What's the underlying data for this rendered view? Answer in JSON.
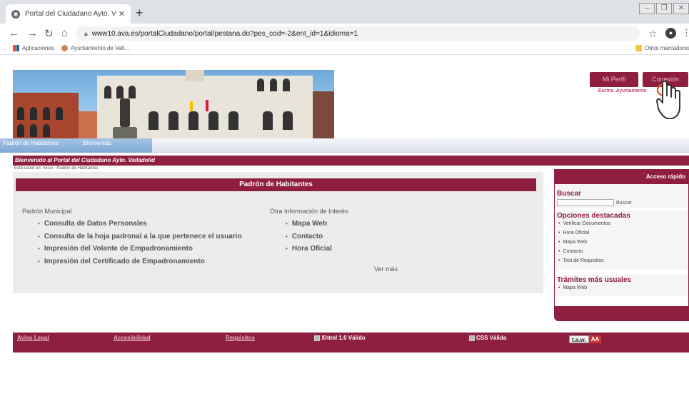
{
  "browser": {
    "tab_title": "Portal del Ciudadano Ayto. Vallado",
    "url": "www10.ava.es/portalCiudadano/portal/pestana.do?pes_cod=-2&ent_id=1&idioma=1",
    "bookmarks": [
      "Aplicaciones",
      "Ayuntamiento de Vall...",
      "Otros marcadores"
    ]
  },
  "header": {
    "mi_perfil": "Mi Perfil",
    "conexion": "Conexión",
    "ayto_link": "Excmo. Ayuntamiento"
  },
  "nav": {
    "tabs": [
      "Padrón de Habitantes",
      "Bienvenida"
    ]
  },
  "welcome": "Bienvenido al Portal del Ciudadano Ayto. Valladolid",
  "breadcrumb": "Está usted en: Inicio · Padrón de Habitantes",
  "main": {
    "title": "Padrón de Habitantes",
    "left_title": "Padrón Municipal",
    "left_items": [
      "Consulta de Datos Personales",
      "Consulta de la hoja padronal a la que pertenece el usuario",
      "Impresión del Volante de Empadronamiento",
      "Impresión del Certificado de Empadronamiento"
    ],
    "right_title": "Otra Información de Interés",
    "right_items": [
      "Mapa Web",
      "Contacto",
      "Hora Oficial"
    ],
    "more": "Ver más"
  },
  "sidebar": {
    "head": "Acceso rápido",
    "search_title": "Buscar",
    "search_button": "Buscar",
    "featured_title": "Opciones destacadas",
    "featured": [
      "Verificar Documentos",
      "Hora Oficial",
      "Mapa Web",
      "Contacto",
      "Test de Requisitos"
    ],
    "tramites_title": "Trámites más usuales",
    "tramites": [
      "Mapa Web"
    ]
  },
  "footer": {
    "links": [
      "Aviso Legal",
      "Accesibilidad",
      "Requisitos"
    ],
    "badges": [
      "Xhtml 1.0 Válido",
      "CSS Válida"
    ],
    "taw": [
      "t.a.w.",
      "AA"
    ]
  },
  "colors": {
    "brand": "#8f1f3e",
    "nav_active": "#7ea9d6"
  }
}
